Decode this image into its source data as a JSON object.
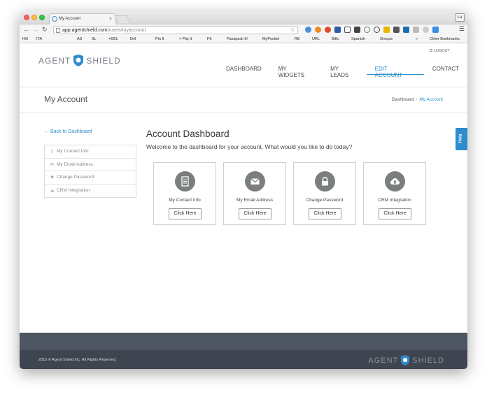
{
  "browser": {
    "tab_title": "My Account",
    "tab_close": "×",
    "user_badge": "Lu",
    "url_host": "app.agentshield.com",
    "url_path": "/users/myaccount",
    "bookmarks": [
      "HG",
      "ITA",
      "AS",
      "SL",
      "+DEL",
      "Del",
      "Pin It",
      "+ Flip It",
      "FIt",
      "Passpack It!",
      "MyPocket",
      "RE",
      "URL",
      "Bills",
      "Spanish",
      "Groups",
      "»",
      "Other Bookmarks"
    ]
  },
  "header": {
    "logout": "LOGOUT",
    "logo_left": "AGENT",
    "logo_right": "SHIELD",
    "nav": [
      "DASHBOARD",
      "MY WIDGETS",
      "MY LEADS",
      "EDIT ACCOUNT",
      "CONTACT"
    ],
    "active_nav": "EDIT ACCOUNT"
  },
  "page": {
    "title": "My Account",
    "breadcrumb": [
      "Dashboard",
      "My Account"
    ]
  },
  "sidebar": {
    "back": "Back to Dashboard",
    "items": [
      {
        "label": "My Contact Info",
        "icon": "document-icon"
      },
      {
        "label": "My Email Address",
        "icon": "envelope-icon"
      },
      {
        "label": "Change Password",
        "icon": "lock-icon"
      },
      {
        "label": "CRM Integration",
        "icon": "cloud-upload-icon"
      }
    ]
  },
  "main": {
    "title": "Account Dashboard",
    "subtitle": "Welcome to the dashboard for your account. What would you like to do today?",
    "cards": [
      {
        "label": "My Contact Info",
        "button": "Click Here",
        "icon": "document-icon"
      },
      {
        "label": "My Email Address",
        "button": "Click Here",
        "icon": "envelope-icon"
      },
      {
        "label": "Change Password",
        "button": "Click Here",
        "icon": "lock-icon"
      },
      {
        "label": "CRM Integration",
        "button": "Click Here",
        "icon": "cloud-upload-icon"
      }
    ]
  },
  "help": "Help",
  "footer": {
    "copyright": "2015 © Agent Shield Inc. All Rights Reserved.",
    "logo_left": "AGENT",
    "logo_right": "SHIELD"
  },
  "colors": {
    "accent": "#2d8ccd",
    "footer_top": "#4e5661",
    "footer_bottom": "#3e4550",
    "icon_circle": "#7a7f7e"
  }
}
